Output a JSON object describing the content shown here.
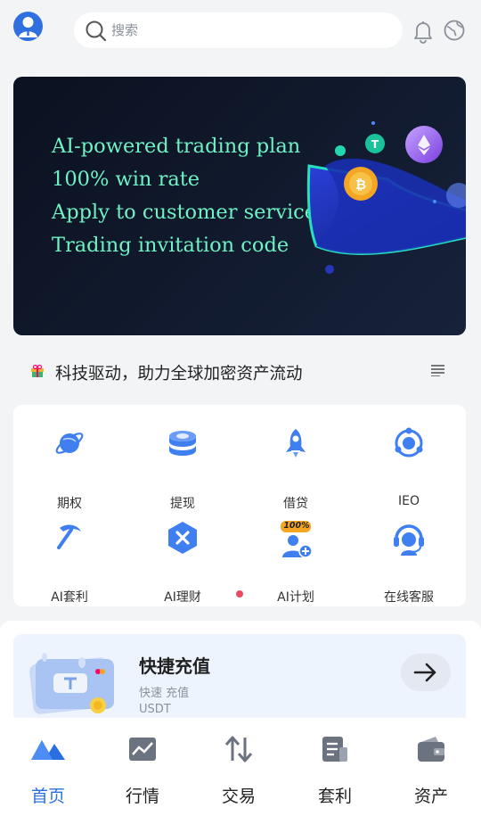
{
  "header": {
    "search_placeholder": "搜索"
  },
  "banner": {
    "lines": [
      "AI-powered trading plan",
      "100% win rate",
      "Apply to customer service",
      "Trading invitation code"
    ]
  },
  "notice": {
    "text": "科技驱动，助力全球加密资产流动"
  },
  "grid": {
    "items": [
      {
        "label": "期权",
        "icon": "planet-icon"
      },
      {
        "label": "提现",
        "icon": "coins-stack-icon"
      },
      {
        "label": "借贷",
        "icon": "rocket-icon"
      },
      {
        "label": "IEO",
        "icon": "orbit-icon"
      },
      {
        "label": "AI套利",
        "icon": "pickaxe-icon"
      },
      {
        "label": "AI理财",
        "icon": "hexagon-x-icon"
      },
      {
        "label": "AI计划",
        "icon": "user-add-icon",
        "badge": "100%"
      },
      {
        "label": "在线客服",
        "icon": "headset-icon"
      }
    ]
  },
  "recharge": {
    "title": "快捷充值",
    "subtitle": "快速 充值 USDT"
  },
  "tabbar": {
    "tabs": [
      {
        "label": "首页",
        "icon": "home-icon",
        "active": true
      },
      {
        "label": "行情",
        "icon": "chart-icon"
      },
      {
        "label": "交易",
        "icon": "swap-icon"
      },
      {
        "label": "套利",
        "icon": "document-icon"
      },
      {
        "label": "资产",
        "icon": "wallet-icon"
      }
    ]
  },
  "colors": {
    "accent": "#2a6fe0",
    "banner_text": "#6ff3c4",
    "icon_blue": "#3f7ff0",
    "indicator": "#e84a5f"
  }
}
